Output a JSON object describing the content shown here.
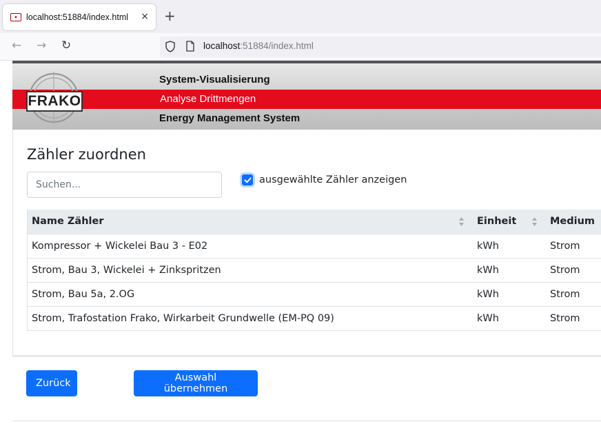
{
  "browser": {
    "tab_title": "localhost:51884/index.html",
    "tab_close": "×",
    "new_tab": "+",
    "url_host": "localhost",
    "url_rest": ":51884/index.html",
    "nav": {
      "back": "←",
      "forward": "→",
      "reload": "↻"
    }
  },
  "banner": {
    "logo_text": "FRAKO",
    "line1": "System-Visualisierung",
    "line2": "Analyse Drittmengen",
    "line3": "Energy Management System",
    "accent_color": "#e30b1c"
  },
  "page": {
    "title": "Zähler zuordnen",
    "search_placeholder": "Suchen...",
    "show_selected_label": "ausgewählte Zähler anzeigen",
    "show_selected_checked": true
  },
  "table": {
    "headers": [
      "Name Zähler",
      "Einheit",
      "Medium"
    ],
    "rows": [
      {
        "name": "Kompressor + Wickelei Bau 3 - E02",
        "unit": "kWh",
        "medium": "Strom"
      },
      {
        "name": "Strom, Bau 3, Wickelei + Zinkspritzen",
        "unit": "kWh",
        "medium": "Strom"
      },
      {
        "name": "Strom, Bau 5a, 2.OG",
        "unit": "kWh",
        "medium": "Strom"
      },
      {
        "name": "Strom, Trafostation Frako, Wirkarbeit Grundwelle (EM-PQ 09)",
        "unit": "kWh",
        "medium": "Strom"
      }
    ]
  },
  "buttons": {
    "back": "Zurück",
    "apply": "Auswahl übernehmen",
    "primary_color": "#0d6efd"
  }
}
